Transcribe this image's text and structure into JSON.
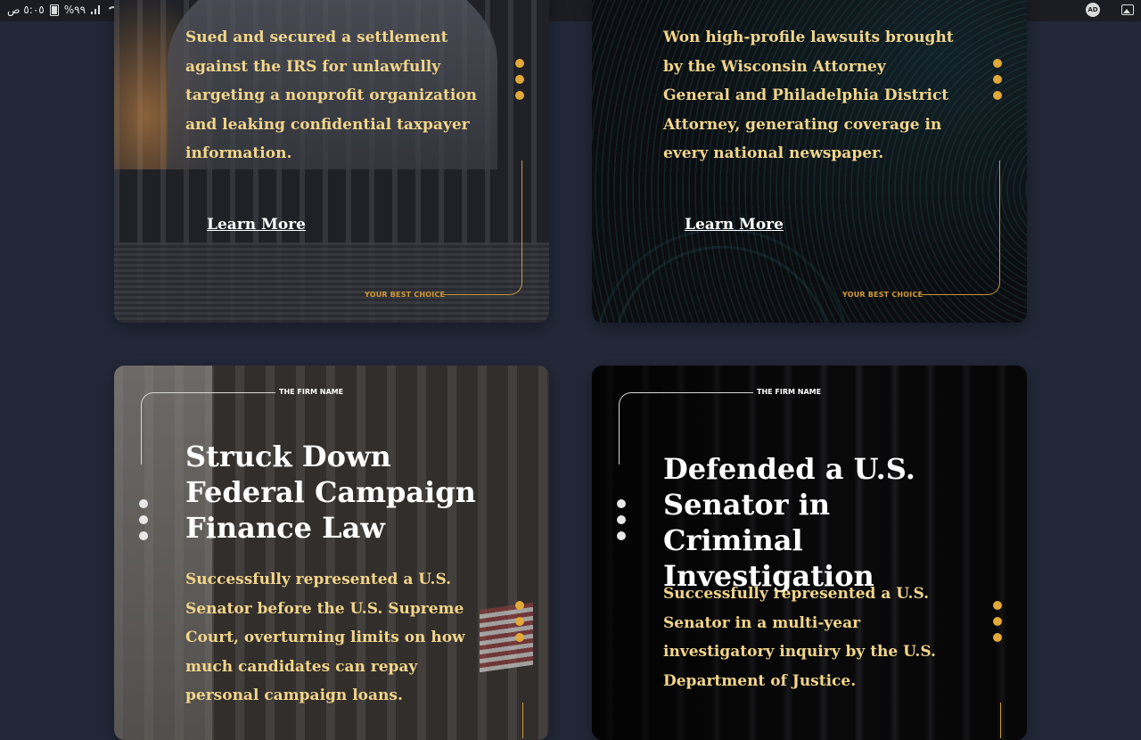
{
  "status_bar": {
    "time": "٥:٠٥ ص",
    "battery": "%٩٩",
    "icons": [
      "battery-icon",
      "signal-icon",
      "wifi-icon",
      "mute-icon",
      "ad-icon",
      "gallery-icon"
    ],
    "ad_label": "AD"
  },
  "colors": {
    "page_bg": "#222838",
    "accent_gold": "#e2a93a",
    "desc_text": "#f2d58a",
    "title_text": "#ffffff"
  },
  "cards": [
    {
      "description": "Sued and secured a settlement against the IRS for unlawfully targeting a nonprofit organization and leaking confidential taxpayer information.",
      "link_label": "Learn More",
      "tag": "YOUR BEST CHOICE"
    },
    {
      "description": "Won high-profile lawsuits brought by the Wisconsin Attorney General and Philadelphia District Attorney, generating coverage in every national newspaper.",
      "link_label": "Learn More",
      "tag": "YOUR BEST CHOICE"
    },
    {
      "tag": "THE FIRM NAME",
      "title": "Struck Down Federal Campaign Finance Law",
      "description": "Successfully represented a U.S. Senator before the U.S. Supreme Court, overturning limits on how much candidates can repay personal campaign loans."
    },
    {
      "tag": "THE FIRM NAME",
      "title": "Defended a U.S. Senator in Criminal Investigation",
      "description": "Successfully represented a U.S. Senator in a multi-year investigatory inquiry by the U.S. Department of Justice."
    }
  ]
}
